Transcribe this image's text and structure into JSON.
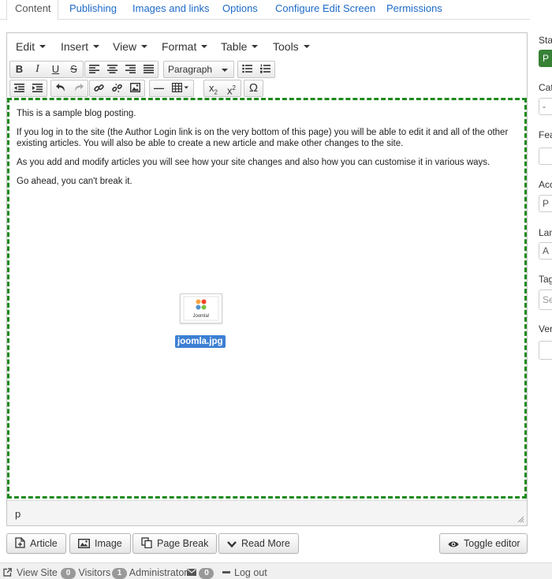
{
  "tabs": [
    {
      "label": "Content"
    },
    {
      "label": "Publishing"
    },
    {
      "label": "Images and links"
    },
    {
      "label": "Options"
    },
    {
      "label": "Configure Edit Screen"
    },
    {
      "label": "Permissions"
    }
  ],
  "menubar": [
    {
      "label": "Edit"
    },
    {
      "label": "Insert"
    },
    {
      "label": "View"
    },
    {
      "label": "Format"
    },
    {
      "label": "Table"
    },
    {
      "label": "Tools"
    }
  ],
  "toolbar": {
    "bold": "B",
    "italic": "I",
    "underline": "U",
    "strikethrough": "S",
    "format_select": "Paragraph",
    "horizontal_rule": "—",
    "subscript": "x",
    "subscript_sub": "2",
    "superscript": "x",
    "superscript_sup": "2",
    "special_char": "Ω"
  },
  "content": {
    "paragraphs": [
      "This is a sample blog posting.",
      "If you log in to the site (the Author Login link is on the very bottom of this page) you will be able to edit it and all of the other existing articles. You will also be able to create a new article and make other changes to the site.",
      "As you add and modify articles you will see how your site changes and also how you can customise it in various ways.",
      "Go ahead, you can't break it."
    ],
    "image_logo_text": "Joomla!",
    "image_filename": "joomla.jpg"
  },
  "statusbar": {
    "path": "p"
  },
  "buttons": {
    "article": "Article",
    "image": "Image",
    "page_break": "Page Break",
    "read_more": "Read More",
    "toggle_editor": "Toggle editor"
  },
  "pagebar": {
    "view_site": "View Site",
    "visitors_count": "0",
    "visitors_label": "Visitors",
    "admin_count": "1",
    "admin_label": "Administrator",
    "messages_count": "0",
    "logout_label": "Log out"
  },
  "sidebar": {
    "status_label": "Sta",
    "status_value": "P",
    "category_label": "Cat",
    "category_value": "-",
    "featured_label": "Fea",
    "access_label": "Acc",
    "access_value": "P",
    "language_label": "Lan",
    "language_value": "A",
    "tags_label": "Tag",
    "tags_placeholder": "Se",
    "version_label": "Ver"
  },
  "colors": {
    "link": "#1d6ac9",
    "content_border": "#1e8a1e",
    "status_published": "#378137",
    "selection": "#3d7fd3"
  }
}
